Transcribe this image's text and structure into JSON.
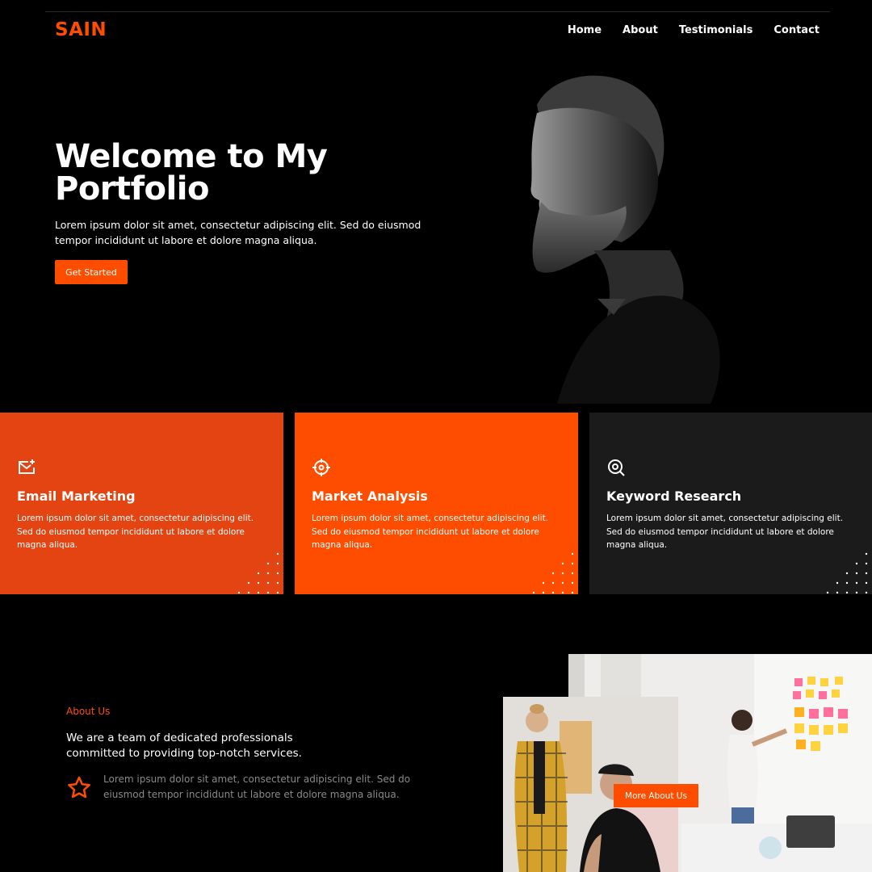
{
  "brand": {
    "logo": "SAIN",
    "accent": "#ff4d00"
  },
  "nav": {
    "items": [
      "Home",
      "About",
      "Testimonials",
      "Contact"
    ]
  },
  "hero": {
    "title": "Welcome to My Portfolio",
    "text": "Lorem ipsum dolor sit amet, consectetur adipiscing elit. Sed do eiusmod tempor incididunt ut labore et dolore magna aliqua.",
    "cta": "Get Started"
  },
  "services": [
    {
      "icon": "mail-star-icon",
      "title": "Email Marketing",
      "text": "Lorem ipsum dolor sit amet, consectetur adipiscing elit. Sed do eiusmod tempor incididunt ut labore et dolore magna aliqua.",
      "color": "#e34412"
    },
    {
      "icon": "crosshair-icon",
      "title": "Market Analysis",
      "text": "Lorem ipsum dolor sit amet, consectetur adipiscing elit. Sed do eiusmod tempor incididunt ut labore et dolore magna aliqua.",
      "color": "#ff4d00"
    },
    {
      "icon": "search-icon",
      "title": "Keyword Research",
      "text": "Lorem ipsum dolor sit amet, consectetur adipiscing elit. Sed do eiusmod tempor incididunt ut labore et dolore magna aliqua.",
      "color": "#1b1b1b"
    }
  ],
  "about": {
    "label": "About Us",
    "heading": "We are a team of dedicated professionals committed to providing top-notch services.",
    "icon": "star-icon",
    "text": "Lorem ipsum dolor sit amet, consectetur adipiscing elit. Sed do eiusmod tempor incididunt ut labore et dolore magna aliqua.",
    "button": "More About Us"
  }
}
